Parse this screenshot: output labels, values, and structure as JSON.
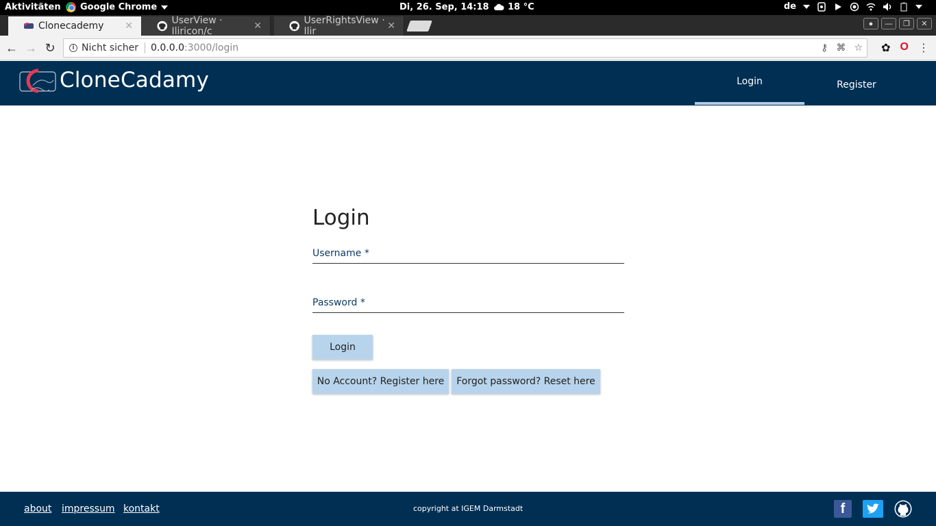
{
  "system_bar": {
    "activities": "Aktivitäten",
    "app_name": "Google Chrome",
    "clock": "Di, 26. Sep, 14:18",
    "weather": "18 °C",
    "keyboard_layout": "de"
  },
  "browser": {
    "tabs": [
      {
        "label": "Clonecademy",
        "icon": "clonecademy-favicon",
        "active": true
      },
      {
        "label": "UserView · Iliricon/c",
        "icon": "github-icon",
        "active": false
      },
      {
        "label": "UserRightsView · Ilir",
        "icon": "github-icon",
        "active": false
      }
    ],
    "address": {
      "security": "Nicht sicher",
      "host": "0.0.0.0",
      "path": ":3000/login"
    }
  },
  "site": {
    "brand": "CloneCadamy",
    "nav": {
      "login": "Login",
      "register": "Register"
    },
    "form": {
      "title": "Login",
      "username_label": "Username *",
      "password_label": "Password *",
      "login_button": "Login",
      "register_button": "No Account? Register here",
      "reset_button": "Forgot password? Reset here"
    },
    "footer": {
      "about": "about",
      "impressum": "impressum",
      "kontakt": "kontakt",
      "copyright": "copyright at IGEM Darmstadt"
    }
  },
  "colors": {
    "header_bg": "#002f54",
    "button_bg": "#b8d4ec",
    "active_tab_underline": "#b3cce6"
  }
}
